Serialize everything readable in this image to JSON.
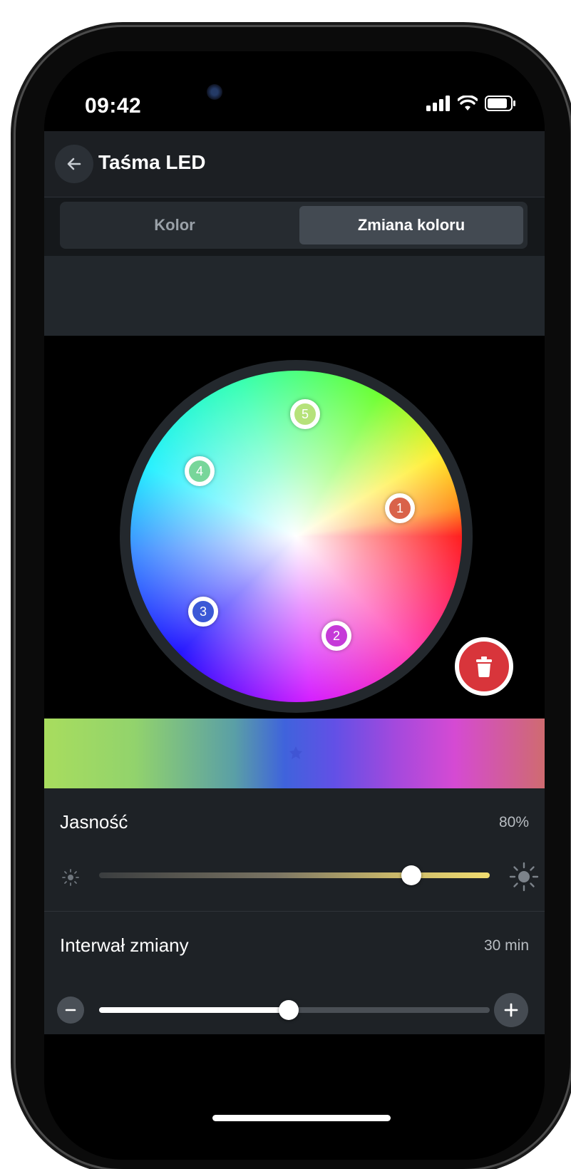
{
  "status_bar": {
    "time": "09:42",
    "icons": [
      "signal-icon",
      "wifi-icon",
      "battery-icon"
    ]
  },
  "header": {
    "title": "Taśma LED",
    "back_icon": "arrow-left-icon"
  },
  "tabs": [
    {
      "label": "Kolor",
      "active": false
    },
    {
      "label": "Zmiana koloru",
      "active": true
    }
  ],
  "color_points": [
    {
      "label": "1",
      "color": "#d9624a"
    },
    {
      "label": "2",
      "color": "#c53ad8"
    },
    {
      "label": "3",
      "color": "#3b58d6"
    },
    {
      "label": "4",
      "color": "#78d69a"
    },
    {
      "label": "5",
      "color": "#b6e27a"
    }
  ],
  "delete_button": {
    "icon": "trash-icon",
    "color": "#d8353b"
  },
  "brightness": {
    "label": "Jasność",
    "value_text": "80%",
    "value": 0.8,
    "min_icon": "sun-small-icon",
    "max_icon": "sun-large-icon"
  },
  "interval": {
    "label": "Interwał zmiany",
    "value_text": "30 min",
    "value": 0.485,
    "decrease_icon": "minus-icon",
    "increase_icon": "plus-icon"
  }
}
